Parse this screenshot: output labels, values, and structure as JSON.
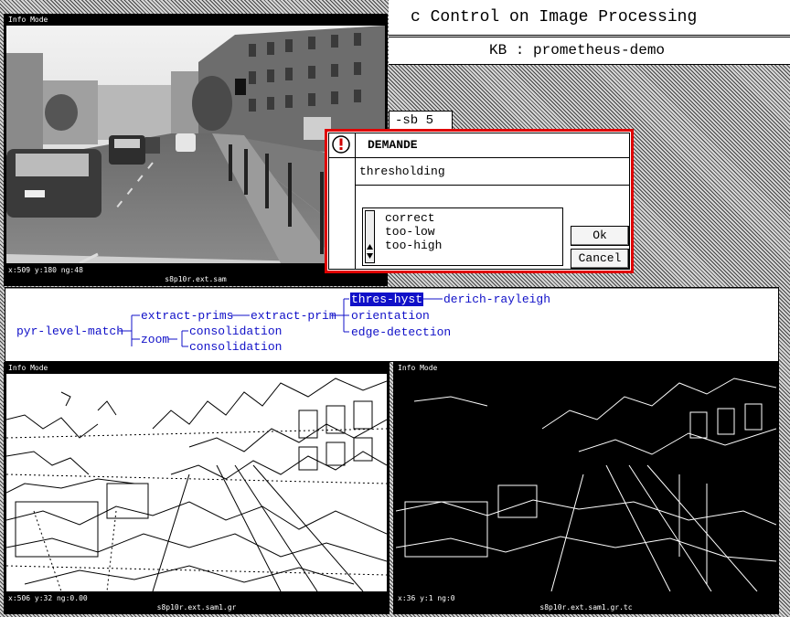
{
  "banner": {
    "title": "c Control on Image Processing",
    "kb_line": "KB : prometheus-demo"
  },
  "side_box": {
    "label": "-sb 5"
  },
  "windows": {
    "source": {
      "mode": "Info Mode",
      "coords": "x:509 y:180 ng:48",
      "filename": "s8p10r.ext.sam"
    },
    "edges_left": {
      "mode": "Info Mode",
      "coords": "x:506 y:32 ng:0.00",
      "filename": "s8p10r.ext.sam1.gr"
    },
    "edges_right": {
      "mode": "Info Mode",
      "coords": "x:36 y:1 ng:0",
      "filename": "s8p10r.ext.sam1.gr.tc"
    }
  },
  "tree": {
    "nodes": {
      "root": "pyr-level-match",
      "extract_prims": "extract-prims",
      "zoom": "zoom",
      "extract_prim": "extract-prim",
      "consolidation_1": "consolidation",
      "consolidation_2": "consolidation",
      "thres_hyst": "thres-hyst",
      "orientation": "orientation",
      "edge_detection": "edge-detection",
      "derich_rayleigh": "derich-rayleigh"
    },
    "selected": "thres-hyst"
  },
  "dialog": {
    "icon": "exclamation-icon",
    "title": "DEMANDE",
    "message": "thresholding",
    "options": [
      "correct",
      "too-low",
      "too-high"
    ],
    "ok_label": "Ok",
    "cancel_label": "Cancel",
    "border_color": "#e00000"
  },
  "colors": {
    "tree_text": "#1010c8",
    "selection_bg": "#1010c8"
  }
}
